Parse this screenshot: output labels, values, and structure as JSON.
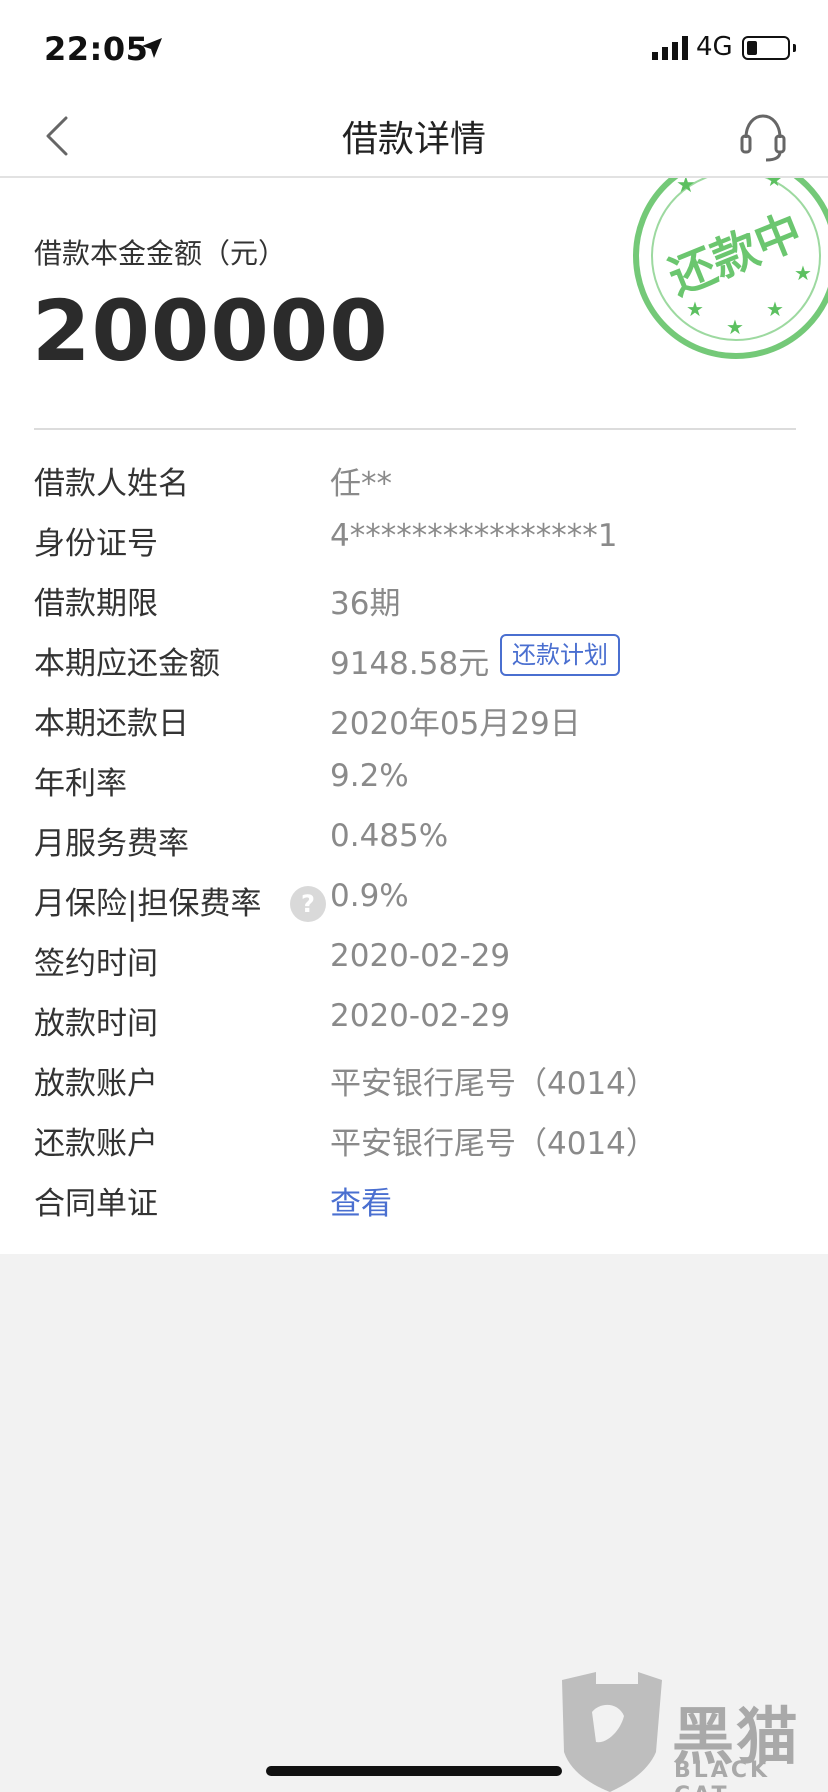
{
  "status_bar": {
    "time": "22:05",
    "network": "4G"
  },
  "nav": {
    "title": "借款详情"
  },
  "principal": {
    "label": "借款本金金额（元）",
    "value": "200000"
  },
  "stamp": {
    "text": "还款中",
    "color": "#5cc060"
  },
  "rows": [
    {
      "label": "借款人姓名",
      "value": "任**"
    },
    {
      "label": "身份证号",
      "value": "4****************1"
    },
    {
      "label": "借款期限",
      "value": "36期"
    },
    {
      "label": "本期应还金额",
      "value": "9148.58元",
      "tag": "还款计划"
    },
    {
      "label": "本期还款日",
      "value": "2020年05月29日"
    },
    {
      "label": "年利率",
      "value": "9.2%"
    },
    {
      "label": "月服务费率",
      "value": "0.485%"
    },
    {
      "label": "月保险|担保费率",
      "value": "0.9%",
      "help_icon": "?"
    },
    {
      "label": "签约时间",
      "value": "2020-02-29"
    },
    {
      "label": "放款时间",
      "value": "2020-02-29"
    },
    {
      "label": "放款账户",
      "value": "平安银行尾号（4014）"
    },
    {
      "label": "还款账户",
      "value": "平安银行尾号（4014）"
    },
    {
      "label": "合同单证",
      "value": "查看"
    }
  ],
  "watermark": {
    "text": "黑猫",
    "subtext": "BLACK CAT"
  },
  "colors": {
    "link": "#4a6fd0",
    "value_gray": "#8a8a8a",
    "stamp_green": "#5cc060"
  }
}
